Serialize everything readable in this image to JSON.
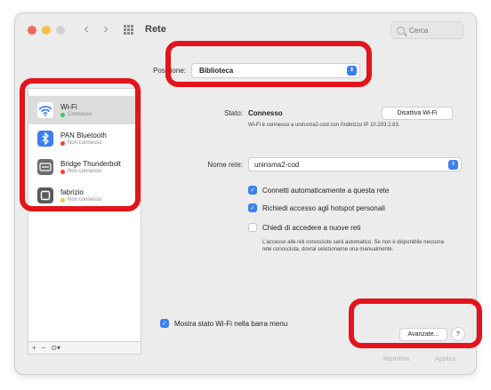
{
  "window": {
    "title": "Rete"
  },
  "toolbar": {
    "back": "‹",
    "forward": "›",
    "search_placeholder": "Cerca"
  },
  "location": {
    "label": "Posizione:",
    "value": "Biblioteca"
  },
  "sidebar": {
    "items": [
      {
        "name": "Wi-Fi",
        "status": "Connesso",
        "status_color": "#34c759",
        "icon": "wifi-icon",
        "icon_bg": "#ffffff",
        "selected": true
      },
      {
        "name": "PAN Bluetooth",
        "status": "Non connesso",
        "status_color": "#ff3b30",
        "icon": "bluetooth-icon",
        "icon_bg": "#3a7ff0",
        "selected": false
      },
      {
        "name": "Bridge Thunderbolt",
        "status": "Non connesso",
        "status_color": "#ff3b30",
        "icon": "thunderbolt-bridge-icon",
        "icon_bg": "#6d6d6d",
        "selected": false
      },
      {
        "name": "fabrizio",
        "status": "Non connesso",
        "status_color": "#f5bf4f",
        "icon": "device-icon",
        "icon_bg": "#5a5a5a",
        "selected": false
      }
    ],
    "bottom": {
      "add": "+",
      "remove": "−",
      "action": "⊙▾"
    }
  },
  "main": {
    "status_label": "Stato:",
    "status_value": "Connesso",
    "disable_wifi": "Disattiva Wi-Fi",
    "status_desc": "Wi-Fi è connesso a uninsma2-cod con l'indirizzo IP 10.203.2.83.",
    "network_label": "Nome rete:",
    "network_value": "uninsma2-cod",
    "auto_connect": "Connetti automaticamente a questa rete",
    "hotspot": "Richiedi accesso agli hotspot personali",
    "ask_join": "Chiedi di accedere a nuove reti",
    "ask_desc": "L'accesso alle reti conosciute sarà automatico. Se non è disponibile nessuna rete conosciuta, dovrai selezionarne una manualmente.",
    "show_status": "Mostra stato Wi-Fi nella barra menu",
    "advanced": "Avanzate...",
    "help": "?",
    "revert": "Ripristina",
    "apply": "Applica"
  },
  "colors": {
    "accent": "#3a7ff0",
    "annotation": "#e3141c"
  }
}
